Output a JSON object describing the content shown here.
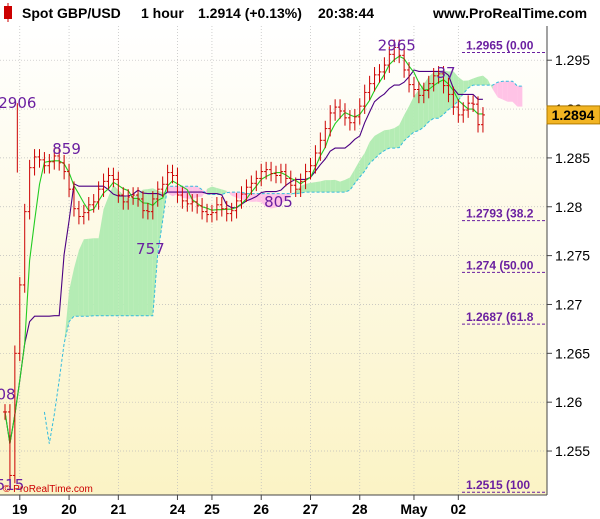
{
  "header": {
    "instrument": "Spot GBP/USD",
    "timeframe": "1 hour",
    "quote": "1.2914 (+0.13%)",
    "time": "20:38:44",
    "site": "www.ProRealTime.com"
  },
  "footer": {
    "copyright": "© ProRealTime.com"
  },
  "current_price_label": "1.2894",
  "chart_data": {
    "type": "line",
    "title": "Spot GBP/USD",
    "ylim": [
      1.2505,
      1.2985
    ],
    "y_ticks": [
      1.25,
      1.255,
      1.26,
      1.265,
      1.27,
      1.275,
      1.28,
      1.285,
      1.29,
      1.295
    ],
    "y_tick_labels": [
      "1.25",
      "1.255",
      "1.26",
      "1.265",
      "1.27",
      "1.275",
      "1.28",
      "1.285",
      "1.29",
      "1.295"
    ],
    "x_range": [
      0,
      110
    ],
    "x_ticks": [
      {
        "label": "19",
        "x": 3
      },
      {
        "label": "20",
        "x": 13
      },
      {
        "label": "21",
        "x": 23
      },
      {
        "label": "24",
        "x": 35
      },
      {
        "label": "25",
        "x": 42
      },
      {
        "label": "26",
        "x": 52
      },
      {
        "label": "27",
        "x": 62
      },
      {
        "label": "28",
        "x": 72
      },
      {
        "label": "May",
        "x": 83
      },
      {
        "label": "02",
        "x": 92
      }
    ],
    "grid": true,
    "current_price": 1.2894,
    "price_series": {
      "x": [
        0,
        1,
        2,
        3,
        4,
        5,
        6,
        7,
        8,
        9,
        10,
        11,
        12,
        13,
        14,
        15,
        16,
        17,
        18,
        19,
        20,
        21,
        22,
        23,
        24,
        25,
        26,
        27,
        28,
        29,
        30,
        31,
        32,
        33,
        34,
        35,
        36,
        37,
        38,
        39,
        40,
        41,
        42,
        43,
        44,
        45,
        46,
        47,
        48,
        49,
        50,
        51,
        52,
        53,
        54,
        55,
        56,
        57,
        58,
        59,
        60,
        61,
        62,
        63,
        64,
        65,
        66,
        67,
        68,
        69,
        70,
        71,
        72,
        73,
        74,
        75,
        76,
        77,
        78,
        79,
        80,
        81,
        82,
        83,
        84,
        85,
        86,
        87,
        88,
        89,
        90,
        91,
        92,
        93,
        94,
        95,
        96,
        97
      ],
      "y": [
        1.259,
        1.2525,
        1.265,
        1.272,
        1.2795,
        1.284,
        1.2851,
        1.2848,
        1.2842,
        1.2846,
        1.2852,
        1.2845,
        1.2836,
        1.2818,
        1.2798,
        1.279,
        1.2794,
        1.2802,
        1.2805,
        1.2818,
        1.2826,
        1.2832,
        1.2828,
        1.2812,
        1.2805,
        1.281,
        1.2812,
        1.2808,
        1.2796,
        1.2795,
        1.2808,
        1.2818,
        1.2823,
        1.2835,
        1.2832,
        1.2812,
        1.2806,
        1.2803,
        1.2805,
        1.2801,
        1.2795,
        1.2792,
        1.2794,
        1.2802,
        1.2798,
        1.2793,
        1.2796,
        1.2806,
        1.2813,
        1.282,
        1.2824,
        1.2829,
        1.2836,
        1.2838,
        1.2834,
        1.2832,
        1.2836,
        1.2829,
        1.2822,
        1.2818,
        1.2826,
        1.2836,
        1.2842,
        1.2855,
        1.2868,
        1.288,
        1.2896,
        1.2902,
        1.2898,
        1.2891,
        1.2886,
        1.2892,
        1.2903,
        1.2917,
        1.2926,
        1.2935,
        1.2938,
        1.2945,
        1.2956,
        1.2963,
        1.2955,
        1.294,
        1.2925,
        1.292,
        1.2914,
        1.2919,
        1.2926,
        1.2934,
        1.2936,
        1.2924,
        1.2915,
        1.2902,
        1.2894,
        1.2899,
        1.2906,
        1.2905,
        1.2884,
        1.2894
      ]
    },
    "annotations": [
      {
        "label": "2906",
        "x": 2.5,
        "y": 1.2906
      },
      {
        "label": "859",
        "x": 12.5,
        "y": 1.2859
      },
      {
        "label": "757",
        "x": 29.5,
        "y": 1.2757
      },
      {
        "label": "805",
        "x": 55.5,
        "y": 1.2805
      },
      {
        "label": "2965",
        "x": 79.5,
        "y": 1.2965
      },
      {
        "label": "37",
        "x": 89.5,
        "y": 1.2937
      },
      {
        "label": "08",
        "x": 0.2,
        "y": 1.2608
      },
      {
        "label": "515",
        "x": 1.0,
        "y": 1.2515
      }
    ],
    "fibonacci_levels": [
      {
        "label": "1.2965 (0.00",
        "value": 1.2965
      },
      {
        "label": "1.2793 (38.2",
        "value": 1.2793
      },
      {
        "label": "1.274 (50.00",
        "value": 1.274
      },
      {
        "label": "1.2687 (61.8",
        "value": 1.2687
      },
      {
        "label": "1.2515 (100",
        "value": 1.2515
      }
    ],
    "colors": {
      "price": "#cc0000",
      "tenkan": "#4b0082",
      "kijun": "#22cc22",
      "cloud_pink": "#ffc3e6",
      "cloud_green": "#b4ecb4",
      "senkou_edge": "#33bbdd",
      "annotation": "#6a1fa0",
      "price_box": "#f2b422"
    }
  }
}
